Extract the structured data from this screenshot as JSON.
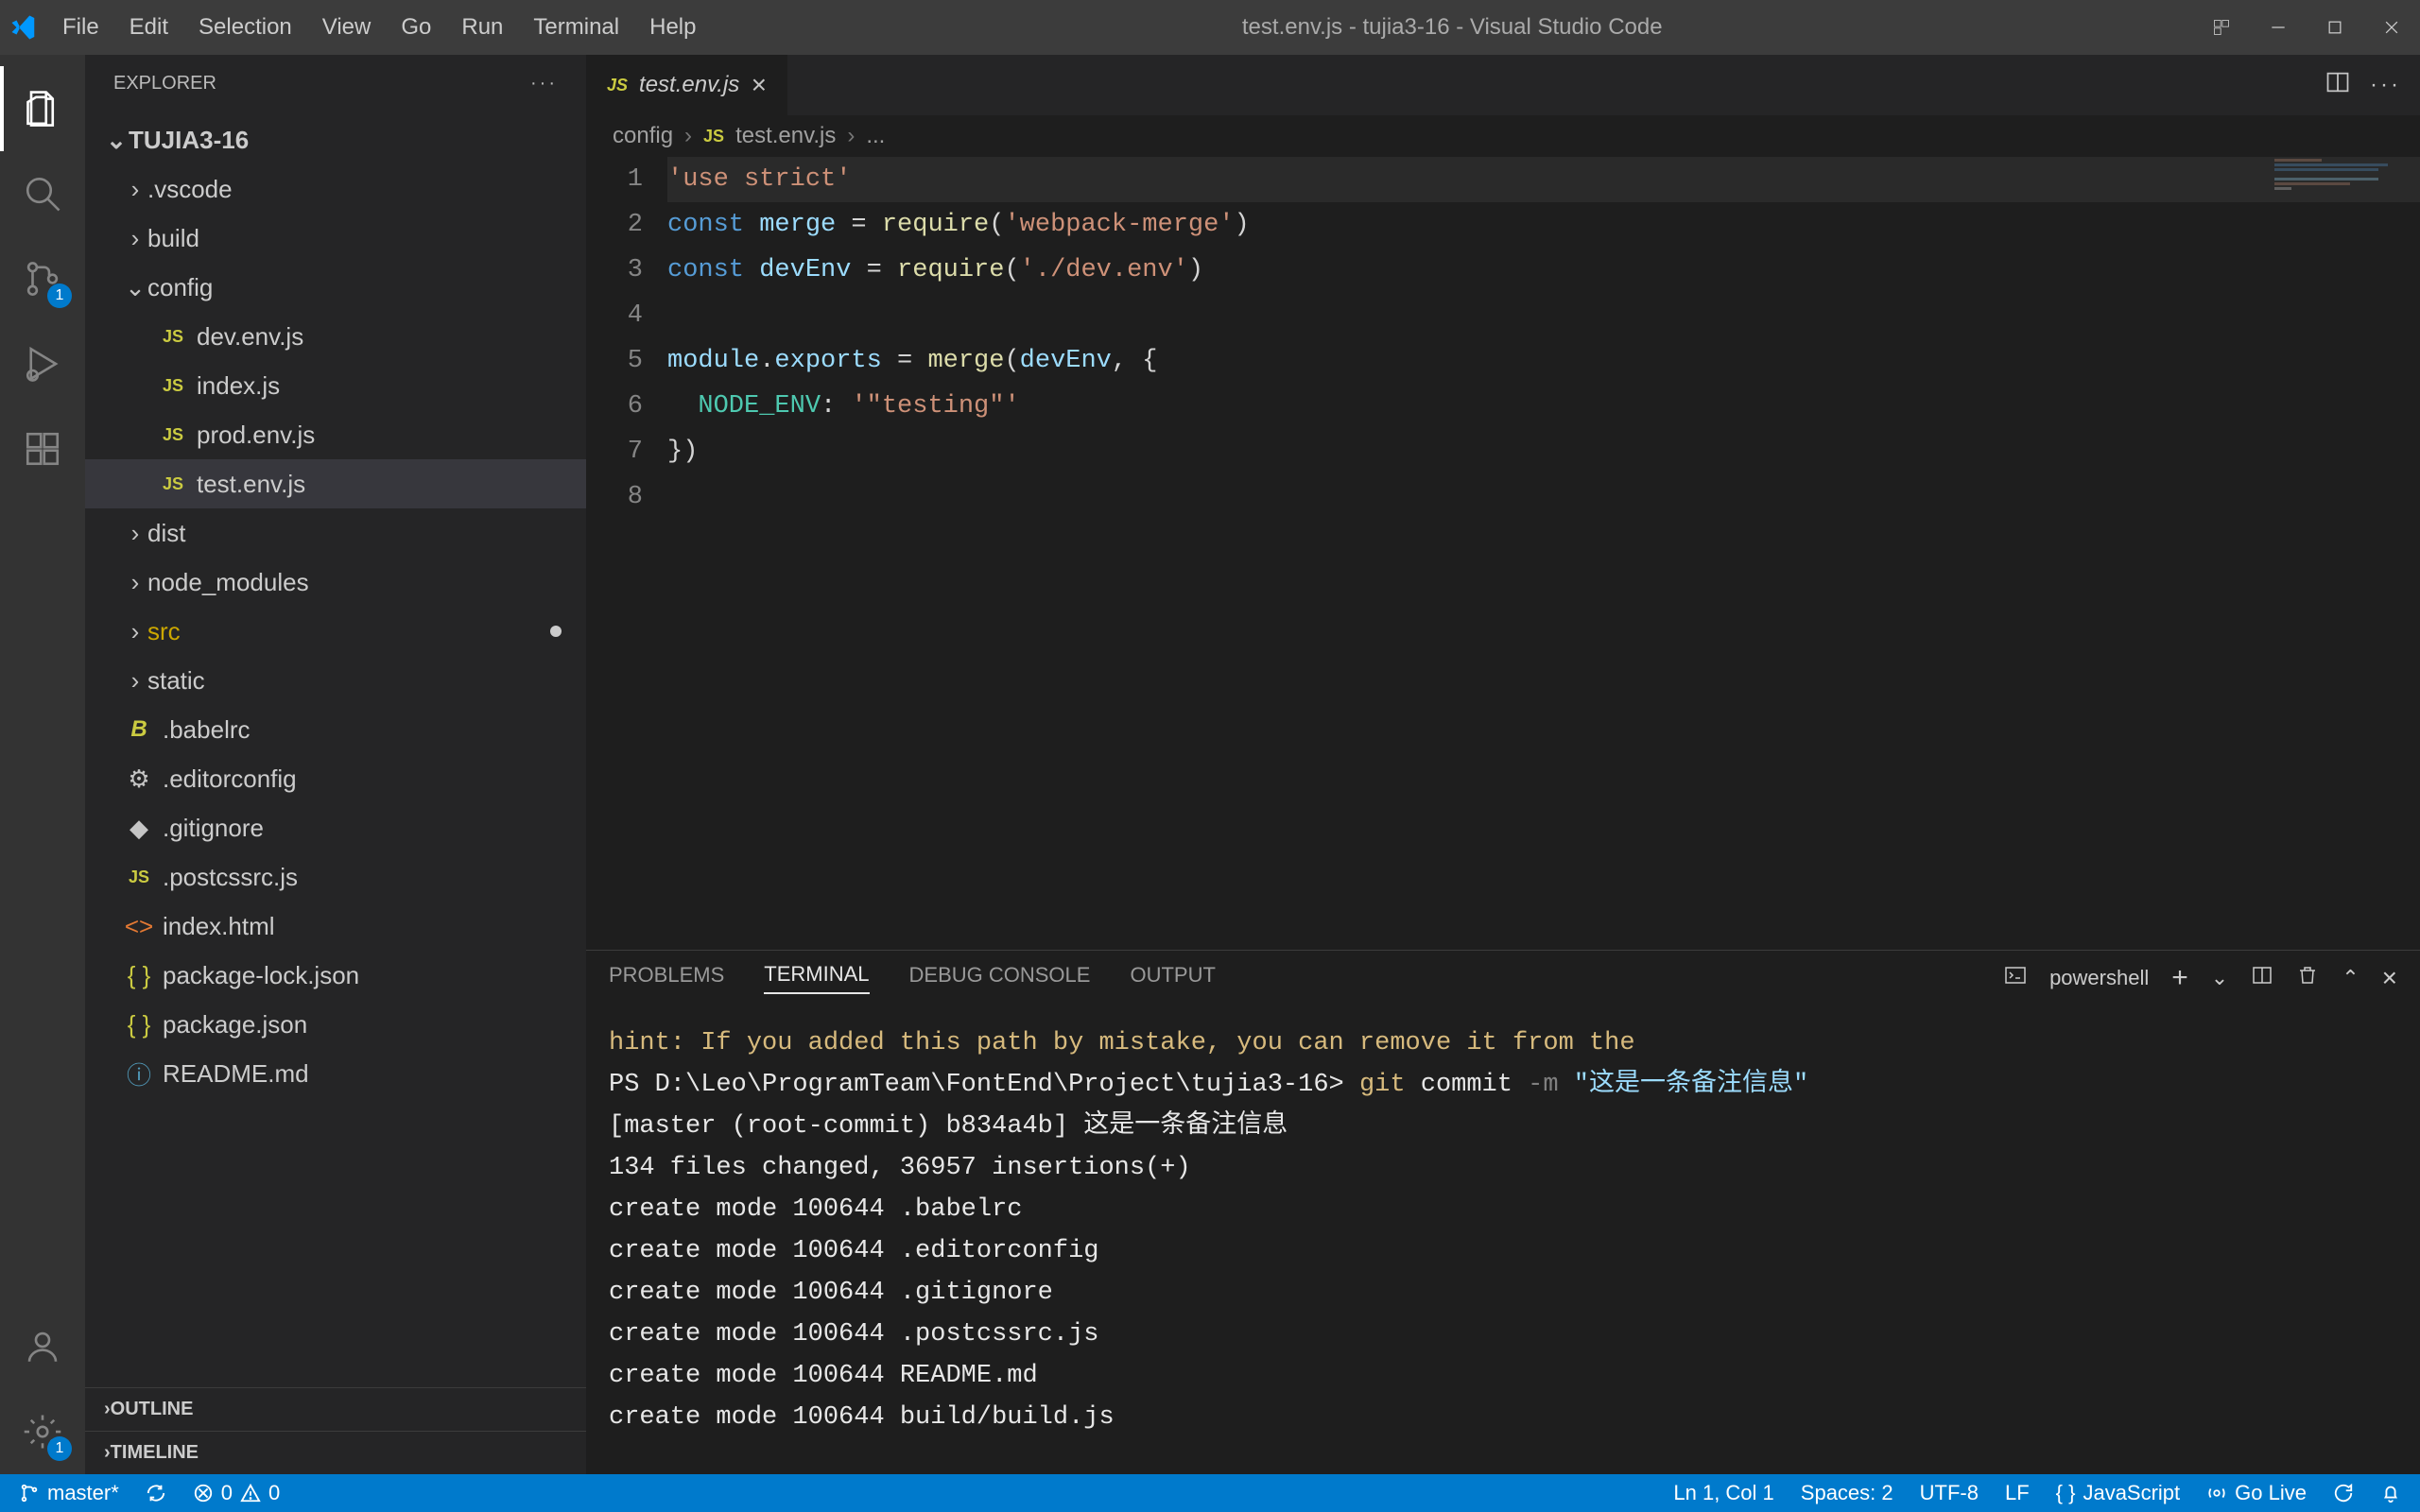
{
  "titlebar": {
    "title": "test.env.js - tujia3-16 - Visual Studio Code"
  },
  "menu": [
    "File",
    "Edit",
    "Selection",
    "View",
    "Go",
    "Run",
    "Terminal",
    "Help"
  ],
  "activitybar": {
    "scm_badge": "1",
    "settings_badge": "1"
  },
  "sidebar": {
    "title": "EXPLORER",
    "root": "TUJIA3-16",
    "folders": [
      {
        "name": ".vscode",
        "expanded": false
      },
      {
        "name": "build",
        "expanded": false
      },
      {
        "name": "config",
        "expanded": true,
        "children": [
          {
            "name": "dev.env.js",
            "icon": "js"
          },
          {
            "name": "index.js",
            "icon": "js"
          },
          {
            "name": "prod.env.js",
            "icon": "js"
          },
          {
            "name": "test.env.js",
            "icon": "js",
            "selected": true
          }
        ]
      },
      {
        "name": "dist",
        "expanded": false
      },
      {
        "name": "node_modules",
        "expanded": false
      },
      {
        "name": "src",
        "expanded": false,
        "modified": true
      },
      {
        "name": "static",
        "expanded": false
      }
    ],
    "files": [
      {
        "name": ".babelrc",
        "icon": "babel"
      },
      {
        "name": ".editorconfig",
        "icon": "gear"
      },
      {
        "name": ".gitignore",
        "icon": "git"
      },
      {
        "name": ".postcssrc.js",
        "icon": "js"
      },
      {
        "name": "index.html",
        "icon": "html"
      },
      {
        "name": "package-lock.json",
        "icon": "json"
      },
      {
        "name": "package.json",
        "icon": "json"
      },
      {
        "name": "README.md",
        "icon": "info"
      }
    ],
    "sections": [
      "OUTLINE",
      "TIMELINE"
    ]
  },
  "tabs": {
    "open": [
      {
        "name": "test.env.js",
        "icon": "js"
      }
    ]
  },
  "breadcrumb": {
    "seg1": "config",
    "seg2": "test.env.js",
    "seg3": "..."
  },
  "editor": {
    "lines": [
      {
        "n": "1",
        "tokens": [
          {
            "t": "'use strict'",
            "c": "str"
          }
        ]
      },
      {
        "n": "2",
        "tokens": [
          {
            "t": "const ",
            "c": "kw"
          },
          {
            "t": "merge",
            "c": "var"
          },
          {
            "t": " = ",
            "c": "plain"
          },
          {
            "t": "require",
            "c": "fn"
          },
          {
            "t": "(",
            "c": "plain"
          },
          {
            "t": "'webpack-merge'",
            "c": "str"
          },
          {
            "t": ")",
            "c": "plain"
          }
        ]
      },
      {
        "n": "3",
        "tokens": [
          {
            "t": "const ",
            "c": "kw"
          },
          {
            "t": "devEnv",
            "c": "var"
          },
          {
            "t": " = ",
            "c": "plain"
          },
          {
            "t": "require",
            "c": "fn"
          },
          {
            "t": "(",
            "c": "plain"
          },
          {
            "t": "'./dev.env'",
            "c": "str"
          },
          {
            "t": ")",
            "c": "plain"
          }
        ]
      },
      {
        "n": "4",
        "tokens": [
          {
            "t": "",
            "c": "plain"
          }
        ]
      },
      {
        "n": "5",
        "tokens": [
          {
            "t": "module",
            "c": "var"
          },
          {
            "t": ".",
            "c": "plain"
          },
          {
            "t": "exports",
            "c": "var"
          },
          {
            "t": " = ",
            "c": "plain"
          },
          {
            "t": "merge",
            "c": "fn"
          },
          {
            "t": "(",
            "c": "plain"
          },
          {
            "t": "devEnv",
            "c": "var"
          },
          {
            "t": ", {",
            "c": "plain"
          }
        ]
      },
      {
        "n": "6",
        "tokens": [
          {
            "t": "  ",
            "c": "plain"
          },
          {
            "t": "NODE_ENV",
            "c": "prop"
          },
          {
            "t": ": ",
            "c": "plain"
          },
          {
            "t": "'\"testing\"'",
            "c": "str"
          }
        ]
      },
      {
        "n": "7",
        "tokens": [
          {
            "t": "})",
            "c": "plain"
          }
        ]
      },
      {
        "n": "8",
        "tokens": [
          {
            "t": "",
            "c": "plain"
          }
        ]
      }
    ]
  },
  "panel": {
    "tabs": [
      "PROBLEMS",
      "TERMINAL",
      "DEBUG CONSOLE",
      "OUTPUT"
    ],
    "active": "TERMINAL",
    "shell": "powershell",
    "lines": [
      {
        "parts": [
          {
            "t": "hint: If you added this path by mistake, you can remove it from the",
            "c": "yellow"
          }
        ]
      },
      {
        "parts": [
          {
            "t": "PS D:\\Leo\\ProgramTeam\\FontEnd\\Project\\tujia3-16> ",
            "c": "white"
          },
          {
            "t": "git ",
            "c": "yellow"
          },
          {
            "t": "commit ",
            "c": "white"
          },
          {
            "t": "-m ",
            "c": "gray"
          },
          {
            "t": "\"这是一条备注信息\"",
            "c": "cyan"
          }
        ]
      },
      {
        "parts": [
          {
            "t": "[master (root-commit) b834a4b] 这是一条备注信息",
            "c": "white"
          }
        ]
      },
      {
        "parts": [
          {
            "t": " 134 files changed, 36957 insertions(+)",
            "c": "white"
          }
        ]
      },
      {
        "parts": [
          {
            "t": " create mode 100644 .babelrc",
            "c": "white"
          }
        ]
      },
      {
        "parts": [
          {
            "t": " create mode 100644 .editorconfig",
            "c": "white"
          }
        ]
      },
      {
        "parts": [
          {
            "t": " create mode 100644 .gitignore",
            "c": "white"
          }
        ]
      },
      {
        "parts": [
          {
            "t": " create mode 100644 .postcssrc.js",
            "c": "white"
          }
        ]
      },
      {
        "parts": [
          {
            "t": " create mode 100644 README.md",
            "c": "white"
          }
        ]
      },
      {
        "parts": [
          {
            "t": " create mode 100644 build/build.js",
            "c": "white"
          }
        ]
      }
    ]
  },
  "status": {
    "branch": "master*",
    "errors": "0",
    "warnings": "0",
    "lncol": "Ln 1, Col 1",
    "spaces": "Spaces: 2",
    "encoding": "UTF-8",
    "eol": "LF",
    "lang": "JavaScript",
    "golive": "Go Live"
  }
}
